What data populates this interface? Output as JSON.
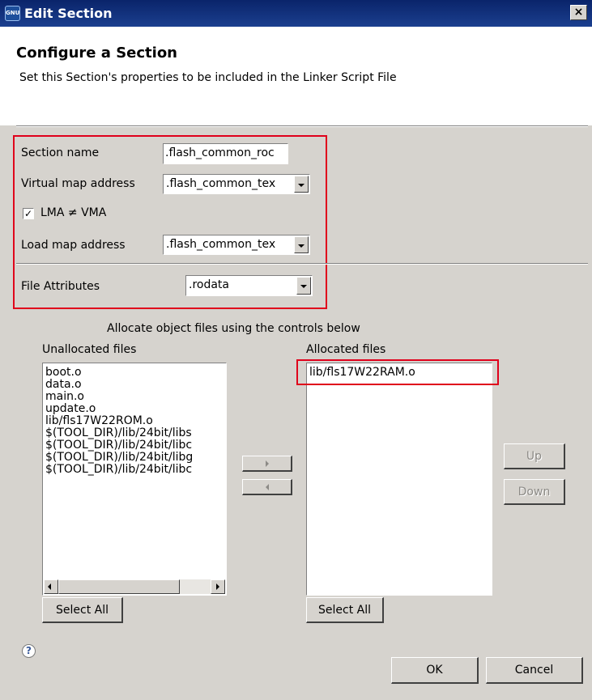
{
  "window": {
    "title": "Edit Section",
    "icon_text": "GNU"
  },
  "header": {
    "title": "Configure a Section",
    "description": "Set this Section's properties to be included in the Linker Script File"
  },
  "form": {
    "section_name_label": "Section name",
    "section_name_value": ".flash_common_roc",
    "virtual_map_label": "Virtual map address",
    "virtual_map_value": ".flash_common_tex",
    "lma_vma_label": "LMA ≠ VMA",
    "lma_vma_checked": true,
    "load_map_label": "Load map address",
    "load_map_value": ".flash_common_tex",
    "file_attributes_label": "File Attributes",
    "file_attributes_value": ".rodata"
  },
  "allocation": {
    "instruction": "Allocate object files using the controls below",
    "unallocated_label": "Unallocated files",
    "unallocated_files": [
      "boot.o",
      "data.o",
      "main.o",
      "update.o",
      "lib/fls17W22ROM.o",
      "$(TOOL_DIR)/lib/24bit/libs",
      "$(TOOL_DIR)/lib/24bit/libc",
      "$(TOOL_DIR)/lib/24bit/libg",
      "$(TOOL_DIR)/lib/24bit/libc"
    ],
    "allocated_label": "Allocated files",
    "allocated_files": [
      "lib/fls17W22RAM.o"
    ],
    "select_all_label": "Select All",
    "up_label": "Up",
    "down_label": "Down"
  },
  "footer": {
    "ok_label": "OK",
    "cancel_label": "Cancel"
  },
  "colors": {
    "highlight": "#e0001b",
    "titlebar": "#0a246a",
    "background": "#d6d3ce"
  }
}
